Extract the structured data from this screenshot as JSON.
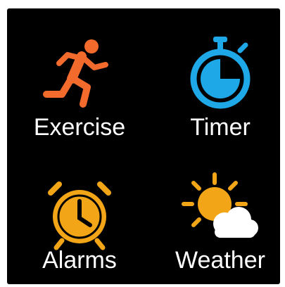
{
  "apps": [
    {
      "label": "Exercise",
      "icon": "running-person-icon",
      "color": "#F26B2D"
    },
    {
      "label": "Timer",
      "icon": "stopwatch-icon",
      "color": "#1FA8E8"
    },
    {
      "label": "Alarms",
      "icon": "alarm-clock-icon",
      "color": "#F2A516"
    },
    {
      "label": "Weather",
      "icon": "sun-behind-cloud-icon",
      "color": "#F2A516"
    }
  ]
}
